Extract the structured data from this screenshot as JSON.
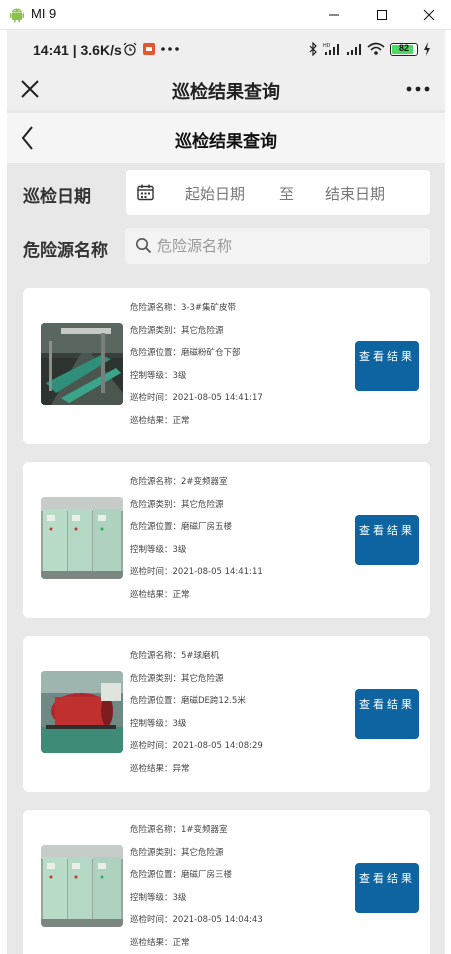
{
  "window": {
    "title": "MI 9",
    "icons": [
      "android-icon",
      "minimize-icon",
      "maximize-icon",
      "close-icon"
    ]
  },
  "status_bar": {
    "time": "14:41",
    "speed": "| 3.6K/s",
    "battery_level": "82",
    "hd_label": "HD"
  },
  "top_bar": {
    "title": "巡检结果查询"
  },
  "nav_bar": {
    "title": "巡检结果查询"
  },
  "filters": {
    "date_label": "巡检日期",
    "start_placeholder": "起始日期",
    "separator": "至",
    "end_placeholder": "结束日期",
    "name_label": "危险源名称",
    "search_placeholder": "危险源名称"
  },
  "records": [
    {
      "name": "危险源名称：3-3#集矿皮带",
      "category": "危险源类别：其它危险源",
      "location": "危险源位置：磨磁粉矿仓下部",
      "level": "控制等级：3级",
      "time": "巡检时间：2021-08-05 14:41:17",
      "result": "巡检结果：正常",
      "image": "conveyor-belt-photo",
      "button": "查看结果"
    },
    {
      "name": "危险源名称：2#变频器室",
      "category": "危险源类别：其它危险源",
      "location": "危险源位置：磨磁厂房五楼",
      "level": "控制等级：3级",
      "time": "巡检时间：2021-08-05 14:41:11",
      "result": "巡检结果：正常",
      "image": "inverter-room-photo",
      "button": "查看结果"
    },
    {
      "name": "危险源名称：5#球磨机",
      "category": "危险源类别：其它危险源",
      "location": "危险源位置：磨磁DE跨12.5米",
      "level": "控制等级：3级",
      "time": "巡检时间：2021-08-05 14:08:29",
      "result": "巡检结果：异常",
      "image": "ball-mill-photo",
      "button": "查看结果"
    },
    {
      "name": "危险源名称：1#变频器室",
      "category": "危险源类别：其它危险源",
      "location": "危险源位置：磨磁厂房三楼",
      "level": "控制等级：3级",
      "time": "巡检时间：2021-08-05 14:04:43",
      "result": "巡检结果：正常",
      "image": "inverter-room-photo",
      "button": "查看结果"
    }
  ],
  "colors": {
    "primary_button": "#0e64a0",
    "page_background": "#e8e8e8",
    "battery_fill": "#4cd964"
  }
}
